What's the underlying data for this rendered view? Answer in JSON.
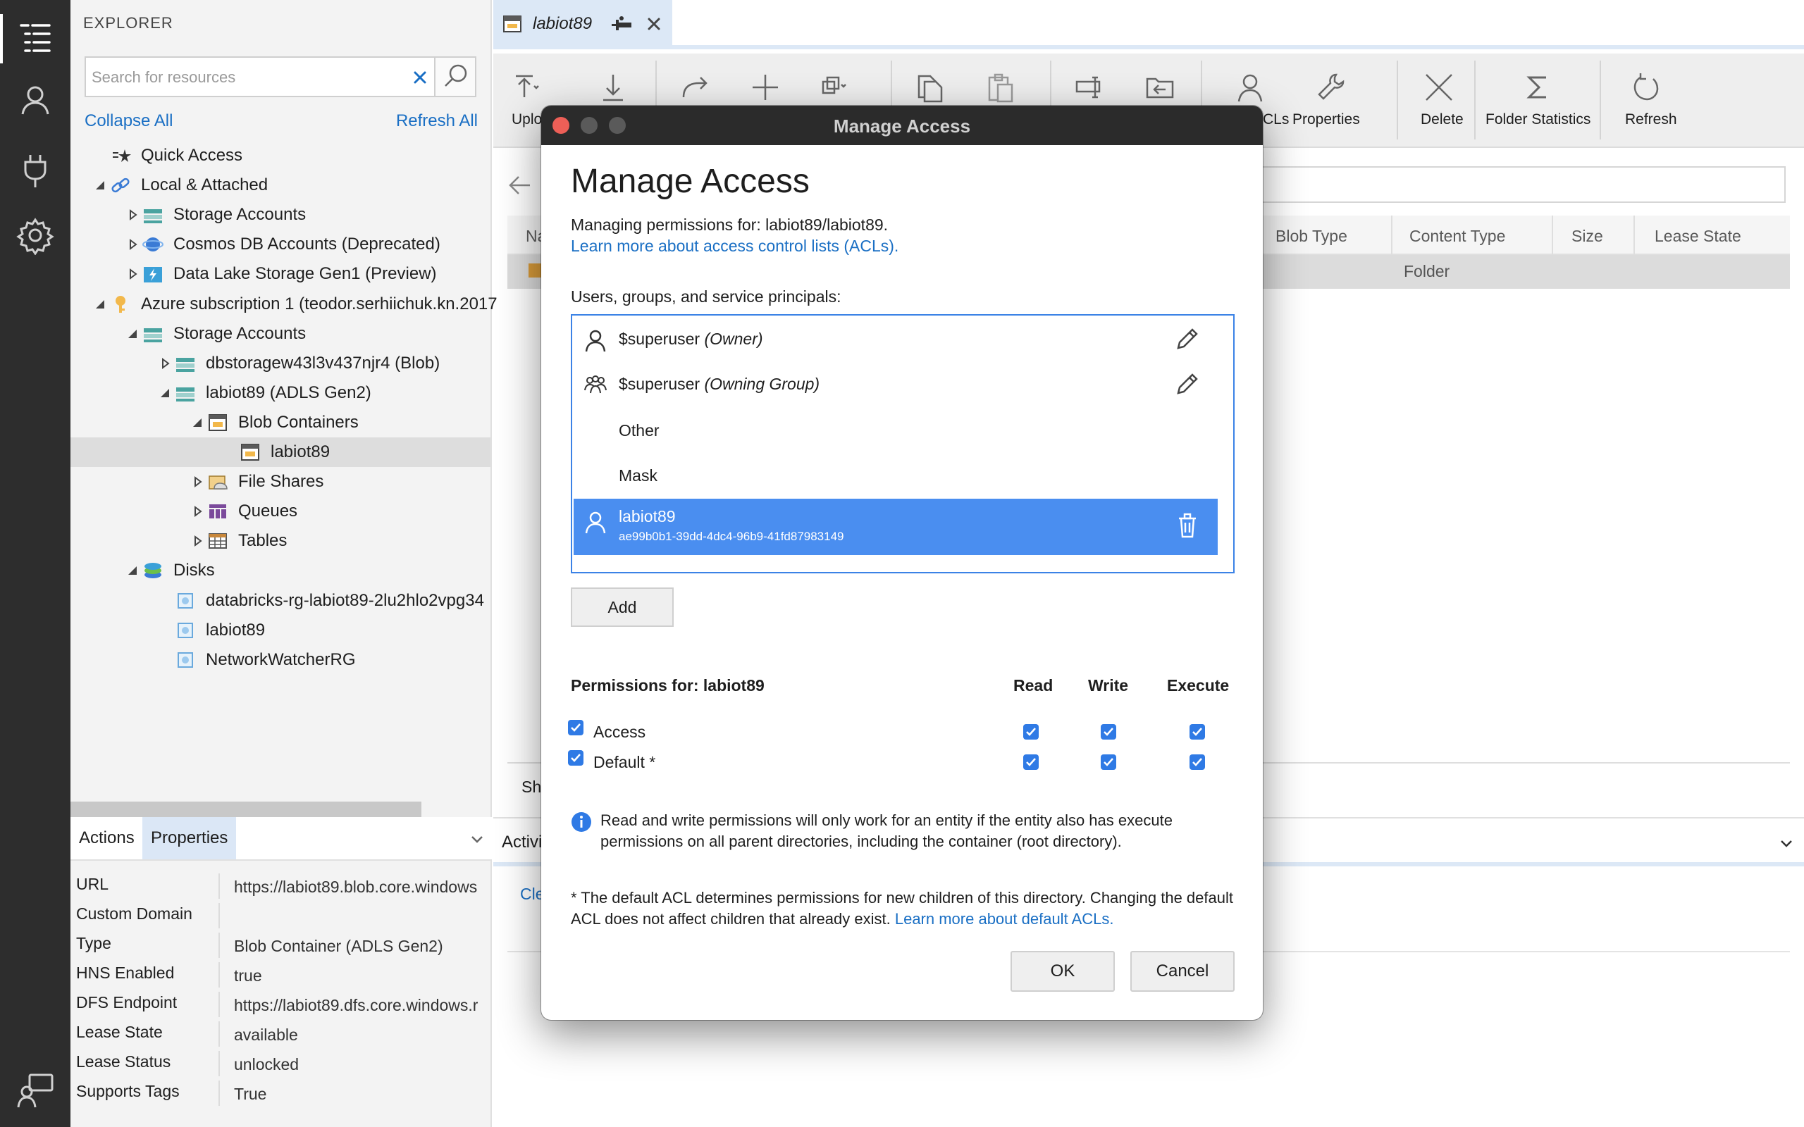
{
  "explorer": {
    "title": "EXPLORER",
    "search_placeholder": "Search for resources",
    "collapse_all": "Collapse All",
    "refresh_all": "Refresh All",
    "tree": [
      {
        "label": "Quick Access",
        "icon": "quick-access-icon",
        "depth": 0,
        "arrow": "none"
      },
      {
        "label": "Local & Attached",
        "icon": "link-icon",
        "depth": 0,
        "arrow": "expanded"
      },
      {
        "label": "Storage Accounts",
        "icon": "storage-account-icon",
        "depth": 1,
        "arrow": "collapsed"
      },
      {
        "label": "Cosmos DB Accounts (Deprecated)",
        "icon": "cosmos-db-icon",
        "depth": 1,
        "arrow": "collapsed"
      },
      {
        "label": "Data Lake Storage Gen1 (Preview)",
        "icon": "data-lake-icon",
        "depth": 1,
        "arrow": "collapsed"
      },
      {
        "label": "Azure subscription 1 (teodor.serhiichuk.kn.2017",
        "icon": "subscription-key-icon",
        "depth": 0,
        "arrow": "expanded"
      },
      {
        "label": "Storage Accounts",
        "icon": "storage-account-icon",
        "depth": 1,
        "arrow": "expanded"
      },
      {
        "label": "dbstoragew43l3v437njr4 (Blob)",
        "icon": "storage-account-icon",
        "depth": 2,
        "arrow": "collapsed"
      },
      {
        "label": "labiot89 (ADLS Gen2)",
        "icon": "storage-account-icon",
        "depth": 2,
        "arrow": "expanded"
      },
      {
        "label": "Blob Containers",
        "icon": "blob-containers-icon",
        "depth": 3,
        "arrow": "expanded"
      },
      {
        "label": "labiot89",
        "icon": "container-icon",
        "depth": 4,
        "arrow": "none",
        "selected": true
      },
      {
        "label": "File Shares",
        "icon": "file-shares-icon",
        "depth": 3,
        "arrow": "collapsed"
      },
      {
        "label": "Queues",
        "icon": "queues-icon",
        "depth": 3,
        "arrow": "collapsed"
      },
      {
        "label": "Tables",
        "icon": "tables-icon",
        "depth": 3,
        "arrow": "collapsed"
      },
      {
        "label": "Disks",
        "icon": "disks-icon",
        "depth": 1,
        "arrow": "expanded"
      },
      {
        "label": "databricks-rg-labiot89-2lu2hlo2vpg34",
        "icon": "disk-group-icon",
        "depth": 2,
        "arrow": "none"
      },
      {
        "label": "labiot89",
        "icon": "disk-group-icon",
        "depth": 2,
        "arrow": "none"
      },
      {
        "label": "NetworkWatcherRG",
        "icon": "disk-group-icon",
        "depth": 2,
        "arrow": "none"
      }
    ]
  },
  "props_panel": {
    "tab_actions": "Actions",
    "tab_properties": "Properties",
    "rows": [
      {
        "key": "URL",
        "value": "https://labiot89.blob.core.windows"
      },
      {
        "key": "Custom Domain",
        "value": ""
      },
      {
        "key": "Type",
        "value": "Blob Container (ADLS Gen2)"
      },
      {
        "key": "HNS Enabled",
        "value": "true"
      },
      {
        "key": "DFS Endpoint",
        "value": "https://labiot89.dfs.core.windows.r"
      },
      {
        "key": "Lease State",
        "value": "available"
      },
      {
        "key": "Lease Status",
        "value": "unlocked"
      },
      {
        "key": "Supports Tags",
        "value": "True"
      }
    ]
  },
  "editor_tab": {
    "label": "labiot89"
  },
  "toolbar": {
    "upload_label": "Uplo",
    "acls_label": "ACLs",
    "properties_label": "Properties",
    "delete_label": "Delete",
    "folder_stats_label": "Folder Statistics",
    "refresh_label": "Refresh"
  },
  "grid": {
    "columns": [
      "Na",
      "Blob Type",
      "Content Type",
      "Size",
      "Lease State"
    ],
    "row_content_type": "Folder"
  },
  "status": {
    "text": "Sh"
  },
  "activities": {
    "title": "Activi",
    "clear": "Cle"
  },
  "modal": {
    "window_title": "Manage Access",
    "heading": "Manage Access",
    "managing_text": "Managing permissions for: labiot89/labiot89.",
    "learn_acl_link": "Learn more about access control lists (ACLs).",
    "principals_label": "Users, groups, and service principals:",
    "principals": [
      {
        "name": "$superuser",
        "role": "(Owner)",
        "icon": "user-icon",
        "editable": true
      },
      {
        "name": "$superuser",
        "role": "(Owning Group)",
        "icon": "group-icon",
        "editable": true
      },
      {
        "name": "Other",
        "role": "",
        "icon": "",
        "editable": false
      },
      {
        "name": "Mask",
        "role": "",
        "icon": "",
        "editable": false
      },
      {
        "name": "labiot89",
        "role": "",
        "sub": "ae99b0b1-39dd-4dc4-96b9-41fd87983149",
        "icon": "user-icon",
        "selected": true
      }
    ],
    "add_label": "Add",
    "permissions_title": "Permissions for: labiot89",
    "col_read": "Read",
    "col_write": "Write",
    "col_execute": "Execute",
    "perm_rows": [
      {
        "label": "Access",
        "enabled": true,
        "read": true,
        "write": true,
        "execute": true
      },
      {
        "label": "Default *",
        "enabled": true,
        "read": true,
        "write": true,
        "execute": true
      }
    ],
    "info_text": "Read and write permissions will only work for an entity if the entity also has execute permissions on all parent directories, including the container (root directory).",
    "default_note": "* The default ACL determines permissions for new children of this directory. Changing the default ACL does not affect children that already exist.",
    "default_link": "Learn more about default ACLs.",
    "ok_label": "OK",
    "cancel_label": "Cancel"
  },
  "colors": {
    "accent": "#3b82e6",
    "selected_row": "#4a8ef0",
    "link": "#1a6fc4",
    "activity_bar": "#2d2d2d",
    "titlebar": "#2b2b2b"
  }
}
